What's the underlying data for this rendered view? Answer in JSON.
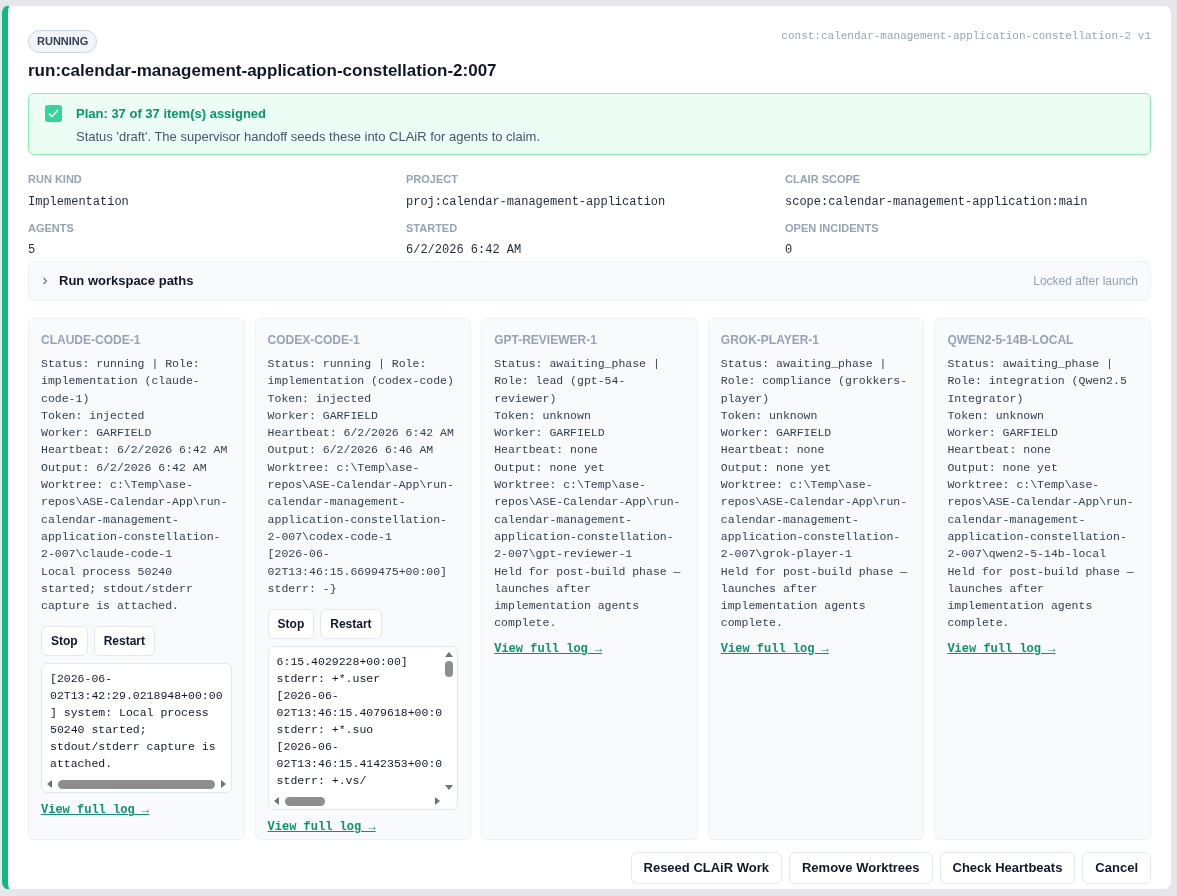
{
  "status_badge": "RUNNING",
  "const_label": "const:calendar-management-application-constellation-2 v1",
  "title": "run:calendar-management-application-constellation-2:007",
  "plan": {
    "checked": true,
    "title": "Plan: 37 of 37 item(s) assigned",
    "text": "Status 'draft'. The supervisor handoff seeds these into CLAiR for agents to claim."
  },
  "fields": [
    {
      "label": "RUN KIND",
      "value": "Implementation"
    },
    {
      "label": "PROJECT",
      "value": "proj:calendar-management-application"
    },
    {
      "label": "CLAIR SCOPE",
      "value": "scope:calendar-management-application:main"
    },
    {
      "label": "AGENTS",
      "value": "5"
    },
    {
      "label": "STARTED",
      "value": "6/2/2026 6:42 AM"
    },
    {
      "label": "OPEN INCIDENTS",
      "value": "0"
    }
  ],
  "workspace": {
    "label": "Run workspace paths",
    "expanded": false,
    "note": "Locked after launch"
  },
  "agents": [
    {
      "name": "CLAUDE-CODE-1",
      "lines": [
        "Status: running | Role: implementation (claude-code-1)",
        "Token: injected",
        "Worker: GARFIELD",
        "Heartbeat: 6/2/2026 6:42 AM",
        "Output: 6/2/2026 6:42 AM",
        "Worktree: c:\\Temp\\ase-repos\\ASE-Calendar-App\\run-calendar-management-application-constellation-2-007\\claude-code-1",
        "Local process 50240 started; stdout/stderr capture is attached."
      ],
      "buttons": [
        "Stop",
        "Restart"
      ],
      "log": {
        "kind": "wrapped",
        "lines": [
          "[2026-06-02T13:42:29.0218948+00:00] system: Local process 50240 started; stdout/stderr capture is attached."
        ]
      },
      "link": "View full log →"
    },
    {
      "name": "CODEX-CODE-1",
      "lines": [
        "Status: running | Role: implementation (codex-code)",
        "Token: injected",
        "Worker: GARFIELD",
        "Heartbeat: 6/2/2026 6:42 AM",
        "Output: 6/2/2026 6:46 AM",
        "Worktree: c:\\Temp\\ase-repos\\ASE-Calendar-App\\run-calendar-management-application-constellation-2-007\\codex-code-1",
        "[2026-06-02T13:46:15.6699475+00:00] stderr: -}"
      ],
      "buttons": [
        "Stop",
        "Restart"
      ],
      "log": {
        "kind": "scrolled",
        "lines": [
          "6:15.4029228+00:00]",
          "stderr: +*.user",
          "[2026-06-",
          "02T13:46:15.4079618+00:0",
          "stderr: +*.suo",
          "[2026-06-",
          "02T13:46:15.4142353+00:0",
          "stderr: +.vs/"
        ]
      },
      "link": "View full log →"
    },
    {
      "name": "GPT-REVIEWER-1",
      "lines": [
        "Status: awaiting_phase | Role: lead (gpt-54-reviewer)",
        "Token: unknown",
        "Worker: GARFIELD",
        "Heartbeat: none",
        "Output: none yet",
        "Worktree: c:\\Temp\\ase-repos\\ASE-Calendar-App\\run-calendar-management-application-constellation-2-007\\gpt-reviewer-1",
        "Held for post-build phase — launches after implementation agents complete."
      ],
      "link": "View full log →"
    },
    {
      "name": "GROK-PLAYER-1",
      "lines": [
        "Status: awaiting_phase | Role: compliance (grokkers-player)",
        "Token: unknown",
        "Worker: GARFIELD",
        "Heartbeat: none",
        "Output: none yet",
        "Worktree: c:\\Temp\\ase-repos\\ASE-Calendar-App\\run-calendar-management-application-constellation-2-007\\grok-player-1",
        "Held for post-build phase — launches after implementation agents complete."
      ],
      "link": "View full log →"
    },
    {
      "name": "QWEN2-5-14B-LOCAL",
      "lines": [
        "Status: awaiting_phase | Role: integration (Qwen2.5 Integrator)",
        "Token: unknown",
        "Worker: GARFIELD",
        "Heartbeat: none",
        "Output: none yet",
        "Worktree: c:\\Temp\\ase-repos\\ASE-Calendar-App\\run-calendar-management-application-constellation-2-007\\qwen2-5-14b-local",
        "Held for post-build phase — launches after implementation agents complete."
      ],
      "link": "View full log →"
    }
  ],
  "footer_buttons": [
    "Reseed CLAiR Work",
    "Remove Worktrees",
    "Check Heartbeats",
    "Cancel"
  ]
}
